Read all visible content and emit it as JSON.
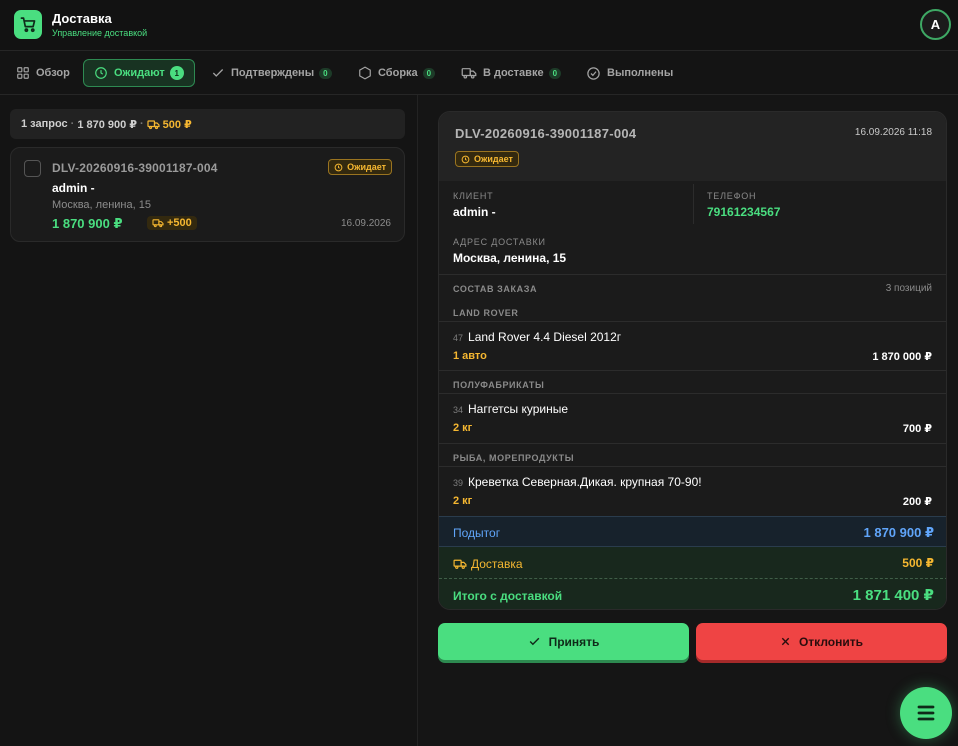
{
  "app": {
    "title": "Доставка",
    "subtitle": "Управление доставкой",
    "avatar": "A"
  },
  "tabs": [
    {
      "label": "Обзор",
      "icon": "grid-icon"
    },
    {
      "label": "Ожидают",
      "count": "1",
      "icon": "clock-icon",
      "active": true
    },
    {
      "label": "Подтверждены",
      "count": "0",
      "icon": "check-icon"
    },
    {
      "label": "Сборка",
      "count": "0",
      "icon": "box-icon"
    },
    {
      "label": "В доставке",
      "count": "0",
      "icon": "truck-icon"
    },
    {
      "label": "Выполнены",
      "icon": "check-circle-icon"
    }
  ],
  "summary": {
    "requests": "1 запрос",
    "total": "1 870 900 ₽",
    "delivery": "500 ₽"
  },
  "order_card": {
    "id": "DLV-20260916-39001187-004",
    "status": "Ожидает",
    "client": "admin -",
    "address": "Москва, ленина, 15",
    "price": "1 870 900 ₽",
    "delivery_fee": "+500",
    "date": "16.09.2026"
  },
  "detail": {
    "id": "DLV-20260916-39001187-004",
    "datetime": "16.09.2026 11:18",
    "status": "Ожидает",
    "client_label": "КЛИЕНТ",
    "client": "admin -",
    "phone_label": "ТЕЛЕФОН",
    "phone": "79161234567",
    "address_label": "АДРЕС ДОСТАВКИ",
    "address": "Москва, ленина, 15",
    "composition_label": "СОСТАВ ЗАКАЗА",
    "positions": "3 позиций",
    "groups": [
      {
        "category": "LAND ROVER",
        "num": "47",
        "name": "Land Rover 4.4 Diesel 2012г",
        "qty": "1 авто",
        "price": "1 870 000 ₽"
      },
      {
        "category": "ПОЛУФАБРИКАТЫ",
        "num": "34",
        "name": "Наггетсы куриные",
        "qty": "2 кг",
        "price": "700 ₽"
      },
      {
        "category": "РЫБА, МОРЕПРОДУКТЫ",
        "num": "39",
        "name": "Креветка Северная.Дикая. крупная 70-90!",
        "qty": "2 кг",
        "price": "200 ₽"
      }
    ],
    "subtotal_label": "Подытог",
    "subtotal": "1 870 900 ₽",
    "delivery_label": "Доставка",
    "delivery": "500 ₽",
    "grand_label": "Итого с доставкой",
    "grand_total": "1 871 400 ₽"
  },
  "actions": {
    "accept": "Принять",
    "reject": "Отклонить"
  },
  "colors": {
    "accent": "#4ade80",
    "warning": "#f5b731",
    "danger": "#ef4444",
    "info": "#60a5fa"
  }
}
